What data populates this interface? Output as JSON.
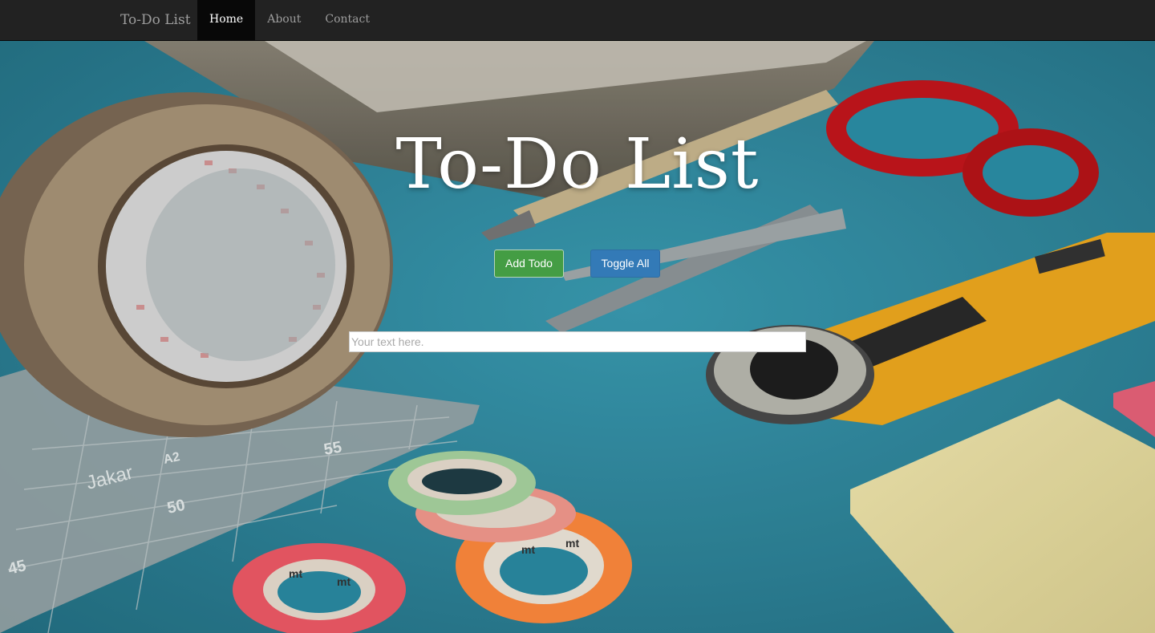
{
  "navbar": {
    "brand": "To-Do List",
    "items": [
      {
        "label": "Home",
        "active": true
      },
      {
        "label": "About",
        "active": false
      },
      {
        "label": "Contact",
        "active": false
      }
    ]
  },
  "hero": {
    "title": "To-Do List",
    "add_button": "Add Todo",
    "toggle_button": "Toggle All",
    "input_placeholder": "Your text here.",
    "input_value": ""
  },
  "background_photo": {
    "cutting_mat_numbers": [
      "55",
      "50",
      "45"
    ],
    "cutting_mat_brand": "Jakar",
    "cutting_mat_size": "A2",
    "washi_tape_text": "mt"
  },
  "colors": {
    "navbar_bg": "#222222",
    "nav_active_bg": "#080808",
    "add_button": "#449d44",
    "toggle_button": "#337ab7",
    "desk": "#2f8fa6"
  }
}
